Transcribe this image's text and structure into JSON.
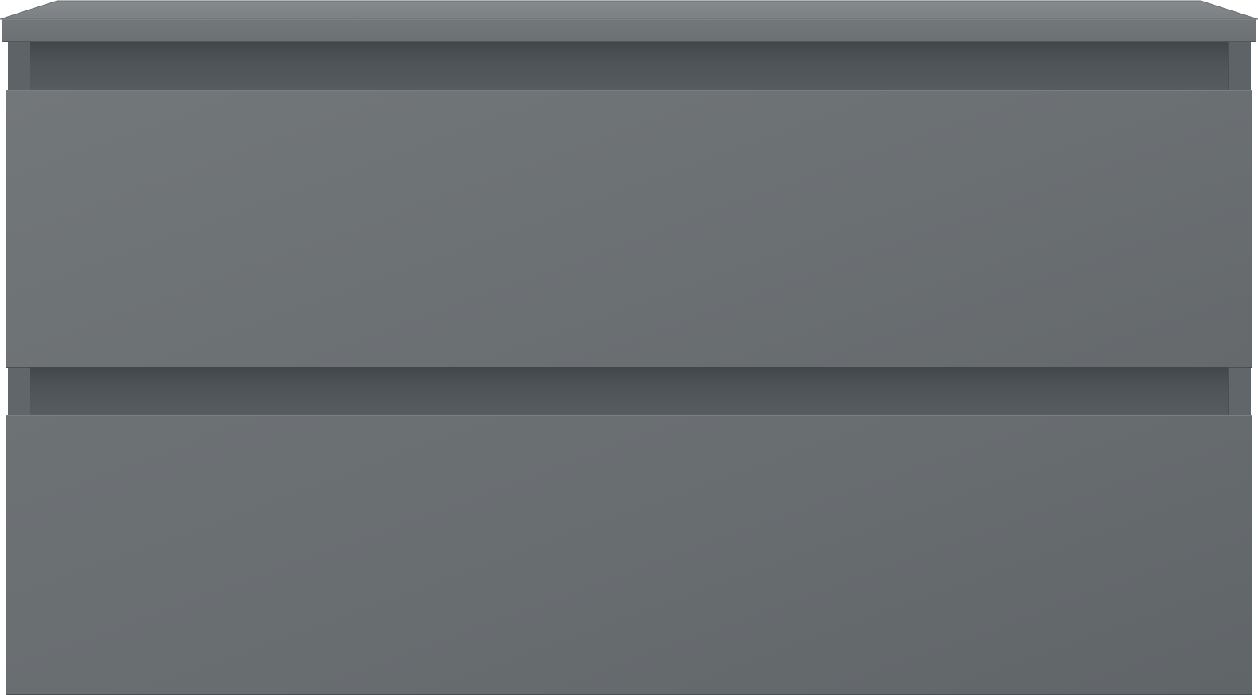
{
  "scene": {
    "subject": "vanity-cabinet-2-drawers",
    "colors": {
      "cabinet_gray": "#6c7174",
      "shadow_gray": "#4e5357",
      "background": "#ffffff"
    },
    "drawers": [
      {
        "id": "upper"
      },
      {
        "id": "lower"
      }
    ]
  }
}
